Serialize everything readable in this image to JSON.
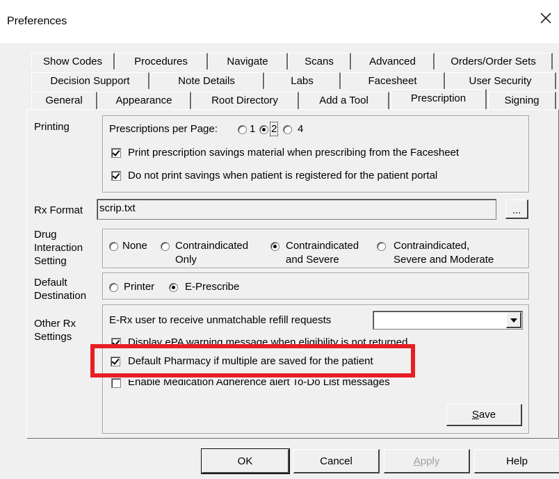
{
  "window": {
    "title": "Preferences",
    "close_glyph": "×"
  },
  "tabs": {
    "row1": [
      "Show Codes",
      "Procedures",
      "Navigate",
      "Scans",
      "Advanced",
      "Orders/Order Sets"
    ],
    "row2": [
      "Decision Support",
      "Note Details",
      "Labs",
      "Facesheet",
      "User Security"
    ],
    "row3": [
      "General",
      "Appearance",
      "Root Directory",
      "Add a Tool",
      "Prescription",
      "Signing"
    ],
    "active": "Prescription"
  },
  "printing": {
    "label": "Printing",
    "per_page_label": "Prescriptions per Page:",
    "options": [
      "1",
      "2",
      "4"
    ],
    "selected": "2",
    "savings_material": "Print prescription savings material when prescribing from the Facesheet",
    "no_savings_portal": "Do not print savings when patient is registered for the patient portal"
  },
  "rx_format": {
    "label": "Rx Format",
    "value": "scrip.txt",
    "browse": "..."
  },
  "drug_interaction": {
    "label_line1": "Drug",
    "label_line2": "Interaction",
    "label_line3": "Setting",
    "none": "None",
    "opt2_l1": "Contraindicated",
    "opt2_l2": "Only",
    "opt3_l1": "Contraindicated",
    "opt3_l2": "and Severe",
    "opt4_l1": "Contraindicated,",
    "opt4_l2": "Severe and Moderate",
    "selected": "Contraindicated and Severe"
  },
  "default_destination": {
    "label_line1": "Default",
    "label_line2": "Destination",
    "printer": "Printer",
    "eprescribe": "E-Prescribe",
    "selected": "E-Prescribe"
  },
  "other_rx": {
    "label_line1": "Other Rx",
    "label_line2": "Settings",
    "erx_user_label": "E-Rx user to receive unmatchable refill requests",
    "erx_user_value": "",
    "display_pba": "Display ePA warning message when eligibility is not returned",
    "default_pharmacy": "Default Pharmacy if multiple are saved for the patient",
    "adherence": "Enable Medication Adherence alert To-Do List messages",
    "save_button": "Save",
    "save_underline_char": "S",
    "save_rest": "ave"
  },
  "footer": {
    "ok": "OK",
    "cancel": "Cancel",
    "apply": "Apply",
    "apply_u": "A",
    "apply_rest": "pply",
    "help": "Help"
  },
  "colors": {
    "highlight": "#e81e25",
    "dialog_bg": "#f0f0f0"
  }
}
